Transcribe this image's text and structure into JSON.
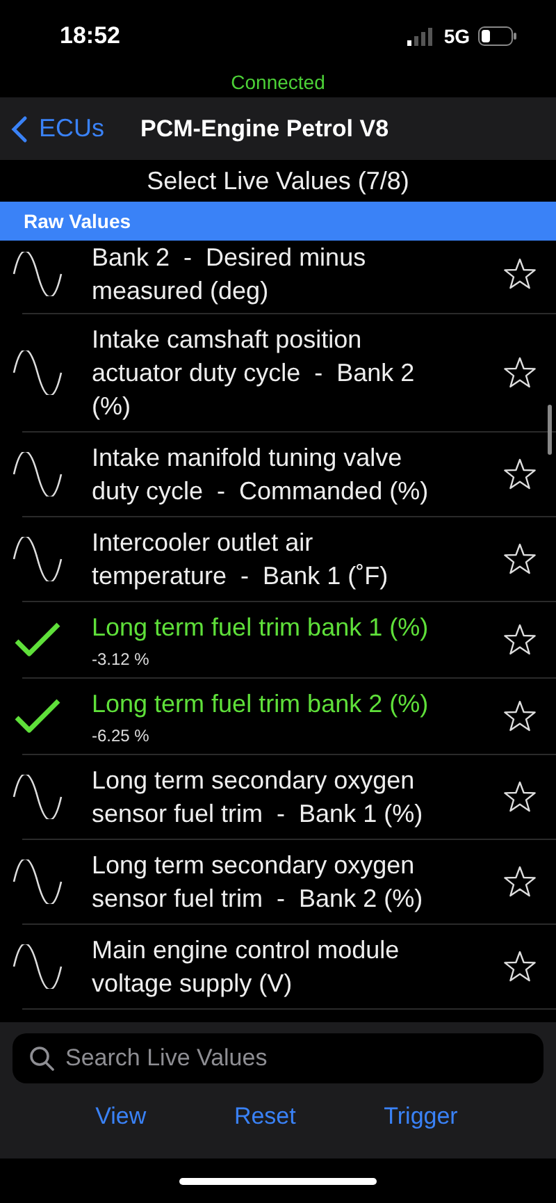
{
  "status_bar": {
    "time": "18:52",
    "network": "5G"
  },
  "connection": "Connected",
  "nav": {
    "back": "ECUs",
    "title": "PCM-Engine Petrol V8"
  },
  "heading": "Select Live Values (7/8)",
  "section": "Raw Values",
  "values": [
    {
      "name": "Bank 2  -  Desired minus measured (deg)",
      "selected": false
    },
    {
      "name": "Intake camshaft position actuator duty cycle  -  Bank 2 (%)",
      "selected": false
    },
    {
      "name": "Intake manifold tuning valve duty cycle  -  Commanded (%)",
      "selected": false
    },
    {
      "name": "Intercooler outlet air temperature  -  Bank 1 (˚F)",
      "selected": false
    },
    {
      "name": "Long term fuel trim bank 1 (%)",
      "selected": true,
      "reading": "-3.12 %"
    },
    {
      "name": "Long term fuel trim bank 2 (%)",
      "selected": true,
      "reading": "-6.25 %"
    },
    {
      "name": "Long term secondary oxygen sensor fuel trim  -  Bank 1 (%)",
      "selected": false
    },
    {
      "name": "Long term secondary oxygen sensor fuel trim  -  Bank 2 (%)",
      "selected": false
    },
    {
      "name": "Main engine control module voltage supply (V)",
      "selected": false
    }
  ],
  "search": {
    "placeholder": "Search Live Values"
  },
  "buttons": [
    "View",
    "Reset",
    "Trigger"
  ]
}
